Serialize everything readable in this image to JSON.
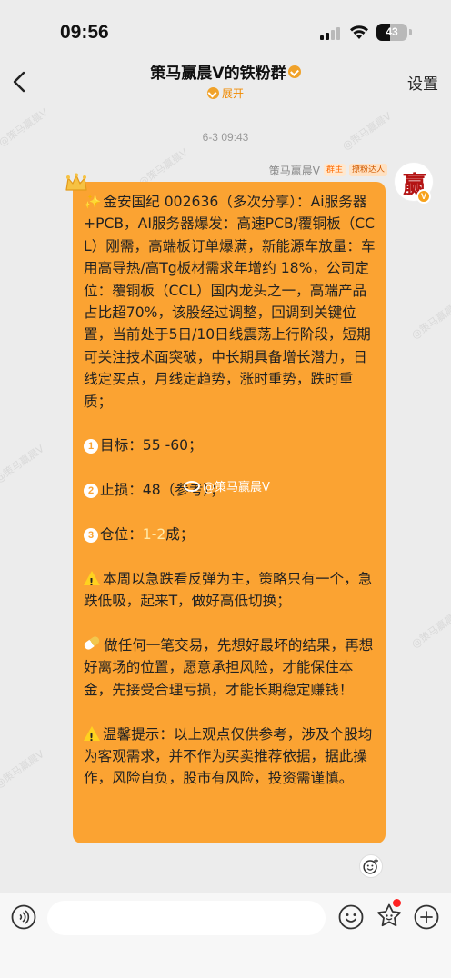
{
  "status_bar": {
    "time": "09:56",
    "battery": "43",
    "battery_level": 0.43
  },
  "header": {
    "title": "策马赢晨V的铁粉群",
    "expand_label": "展开",
    "settings_label": "设置"
  },
  "chat": {
    "timestamp": "6-3 09:43",
    "watermark_text": "@策马赢晨V",
    "message": {
      "sender_name": "策马赢晨V",
      "tags": [
        "群主",
        "撩粉达人"
      ],
      "avatar_char": "赢",
      "avatar_badge": "V",
      "paragraph_intro": "金安国纪 002636（多次分享）：Ai服务器+PCB，AI服务器爆发：高速PCB/覆铜板（CCL）刚需，高端板订单爆满，新能源车放量：车用高导热/高Tg板材需求年增约 18%，公司定位：覆铜板（CCL）国内龙头之一，高端产品占比超70%，该股经过调整，回调到关键位置，当前处于5日/10日线震荡上行阶段，短期可关注技术面突破，中长期具备增长潜力，日线定买点，月线定趋势，涨时重势，跌时重质；",
      "target_num": "1",
      "target_label": "目标：",
      "target_value": "55 -60；",
      "stop_num": "2",
      "stop_label": "止损：",
      "stop_value": "48（参考）；",
      "position_num": "3",
      "position_label": "仓位：",
      "position_value": "1-2",
      "position_suffix": "成；",
      "para_week": "本周以急跌看反弹为主，策略只有一个，急跌低吸，起来T，做好高低切换；",
      "para_trade": "做任何一笔交易，先想好最坏的结果，再想好离场的位置，愿意承担风险，才能保住本金，先接受合理亏损，才能长期稳定赚钱！",
      "para_tips": "温馨提示：以上观点仅供参考，涉及个股均为客观需求，并不作为买卖推荐依据，据此操作，风险自负，股市有风险，投资需谨慎。",
      "image_watermark": "@策马赢晨V"
    }
  },
  "input": {
    "placeholder": ""
  },
  "colors": {
    "bubble": "#fba332",
    "accent": "#f08a00",
    "background": "#ececec"
  },
  "icons": [
    "back-icon",
    "signal-icon",
    "wifi-icon",
    "battery-icon",
    "voice-icon",
    "emoji-icon",
    "sticker-icon",
    "plus-icon",
    "reaction-icon",
    "crown-icon",
    "warning-icon",
    "pill-icon",
    "sparkle-icon"
  ]
}
